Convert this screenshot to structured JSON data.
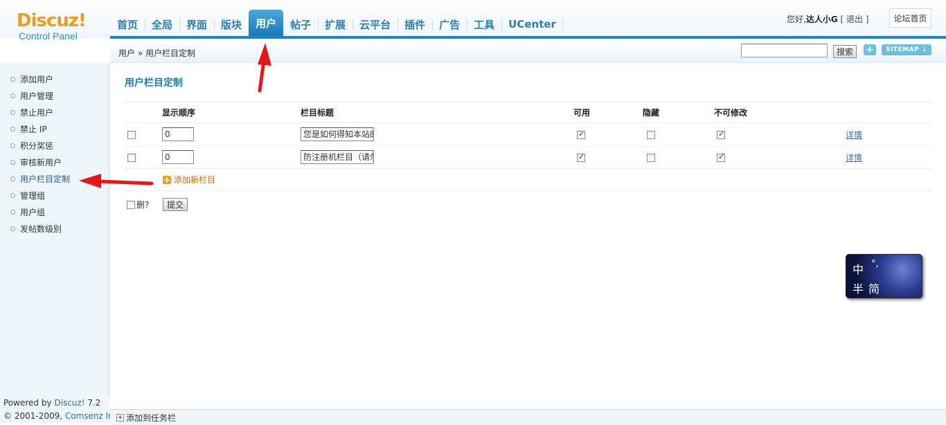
{
  "logo": {
    "brand": "Discuz!",
    "subtitle": "Control Panel"
  },
  "nav": {
    "tabs": [
      {
        "label": "首页",
        "name": "tab-home"
      },
      {
        "label": "全局",
        "name": "tab-global"
      },
      {
        "label": "界面",
        "name": "tab-interface"
      },
      {
        "label": "版块",
        "name": "tab-forums"
      },
      {
        "label": "用户",
        "name": "tab-users"
      },
      {
        "label": "帖子",
        "name": "tab-posts"
      },
      {
        "label": "扩展",
        "name": "tab-extend"
      },
      {
        "label": "云平台",
        "name": "tab-cloud"
      },
      {
        "label": "插件",
        "name": "tab-plugins"
      },
      {
        "label": "广告",
        "name": "tab-ads"
      },
      {
        "label": "工具",
        "name": "tab-tools"
      },
      {
        "label": "UCenter",
        "name": "tab-ucenter"
      }
    ],
    "active": "用户"
  },
  "header": {
    "greeting": "您好,",
    "username": "达人小G",
    "logout_open": " [ ",
    "logout": "退出",
    "logout_close": " ]",
    "forum_home": "论坛首页"
  },
  "breadcrumb": {
    "root": "用户",
    "separator": " » ",
    "current": "用户栏目定制"
  },
  "search": {
    "placeholder": "",
    "button": "搜索",
    "plus": "+",
    "sitemap": "SITEMAP ⇣"
  },
  "sidebar": {
    "items": [
      {
        "label": "添加用户"
      },
      {
        "label": "用户管理"
      },
      {
        "label": "禁止用户"
      },
      {
        "label": "禁止 IP"
      },
      {
        "label": "积分奖惩"
      },
      {
        "label": "审核新用户"
      },
      {
        "label": "用户栏目定制"
      },
      {
        "label": "管理组"
      },
      {
        "label": "用户组"
      },
      {
        "label": "发帖数级别"
      }
    ],
    "active_index": 6
  },
  "main": {
    "title": "用户栏目定制",
    "columns": {
      "order": "显示顺序",
      "title": "栏目标题",
      "available": "可用",
      "hidden": "隐藏",
      "locked": "不可修改"
    },
    "rows": [
      {
        "order": "0",
        "title": "您是如何得知本站的",
        "available": true,
        "hidden": false,
        "locked": true,
        "detail": "详情"
      },
      {
        "order": "0",
        "title": "防注册机栏目（请勿删除）",
        "available": true,
        "hidden": false,
        "locked": true,
        "detail": "详情"
      }
    ],
    "add_new": "添加新栏目",
    "delete_label": "删?",
    "submit": "提交"
  },
  "ime": {
    "line1a": "中",
    "line1b": "°,",
    "line2a": "半",
    "line2b": "简"
  },
  "footer": {
    "powered_prefix": "Powered by ",
    "powered_brand": "Discuz!",
    "version": " 7.2",
    "copyright_prefix": "© 2001-2009, ",
    "company": "Comsenz Inc."
  },
  "taskbar": {
    "add": "添加到任务栏"
  }
}
